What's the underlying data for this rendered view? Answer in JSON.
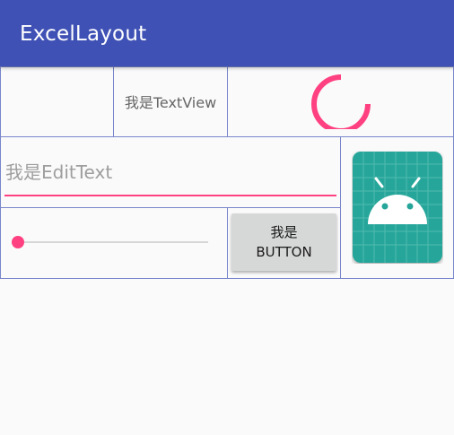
{
  "appbar": {
    "title": "ExcelLayout",
    "color": "#3f51b5"
  },
  "table": {
    "textview_text": "我是TextView",
    "edittext_placeholder": "我是EditText",
    "button_line1": "我是",
    "button_line2": "BUTTON",
    "seekbar_progress": 0.0,
    "spinner_icon": "progress-spinner-icon",
    "image_icon": "android-launcher-icon"
  },
  "colors": {
    "accent": "#ff4081",
    "grid_line": "#7986cb",
    "icon_background": "#26a69a"
  }
}
